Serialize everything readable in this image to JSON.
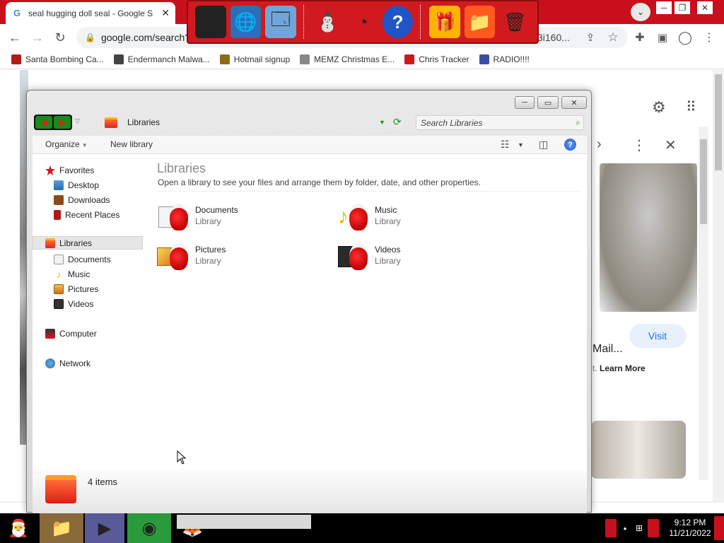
{
  "browser": {
    "tab_title": "seal hugging doll seal - Google S",
    "tab_close": "✕",
    "url": "google.com/search?",
    "url_tail": "3i160...",
    "bookmarks": [
      {
        "label": "Santa Bombing Ca...",
        "icon": "santa-icon",
        "color": "#b31b1b"
      },
      {
        "label": "Endermanch Malwa...",
        "icon": "cat-icon",
        "color": "#444444"
      },
      {
        "label": "Hotmail signup",
        "icon": "person-icon",
        "color": "#8a6d1a"
      },
      {
        "label": "MEMZ Christmas E...",
        "icon": "nyan-icon",
        "color": "#888888"
      },
      {
        "label": "Chris Tracker",
        "icon": "gift-icon",
        "color": "#cc1a1a"
      },
      {
        "label": "RADIO!!!!",
        "icon": "star-icon",
        "color": "#3b4fa0"
      }
    ]
  },
  "google": {
    "visit_label": "Visit",
    "mail_label": "Mail...",
    "learn_more_label": "Learn More",
    "learn_more_prefix": "t."
  },
  "explorer": {
    "breadcrumb": "Libraries",
    "search_placeholder": "Search Libraries",
    "commands": {
      "organize": "Organize",
      "new_library": "New library"
    },
    "nav": {
      "favorites": "Favorites",
      "desktop": "Desktop",
      "downloads": "Downloads",
      "recent_places": "Recent Places",
      "libraries": "Libraries",
      "documents": "Documents",
      "music": "Music",
      "pictures": "Pictures",
      "videos": "Videos",
      "computer": "Computer",
      "network": "Network"
    },
    "content": {
      "heading": "Libraries",
      "description": "Open a library to see your files and arrange them by folder, date, and other properties.",
      "items": [
        {
          "name": "Documents",
          "type": "Library",
          "icon": "documents-library-icon"
        },
        {
          "name": "Music",
          "type": "Library",
          "icon": "music-library-icon"
        },
        {
          "name": "Pictures",
          "type": "Library",
          "icon": "pictures-library-icon"
        },
        {
          "name": "Videos",
          "type": "Library",
          "icon": "videos-library-icon"
        }
      ]
    },
    "details": {
      "count": "4 items"
    }
  },
  "taskbar": {
    "time": "9:12 PM",
    "date": "11/21/2022"
  },
  "colors": {
    "theme_red": "#c8101c",
    "accent_blue": "#1a73e8",
    "nav_green": "#1a8a1a"
  }
}
